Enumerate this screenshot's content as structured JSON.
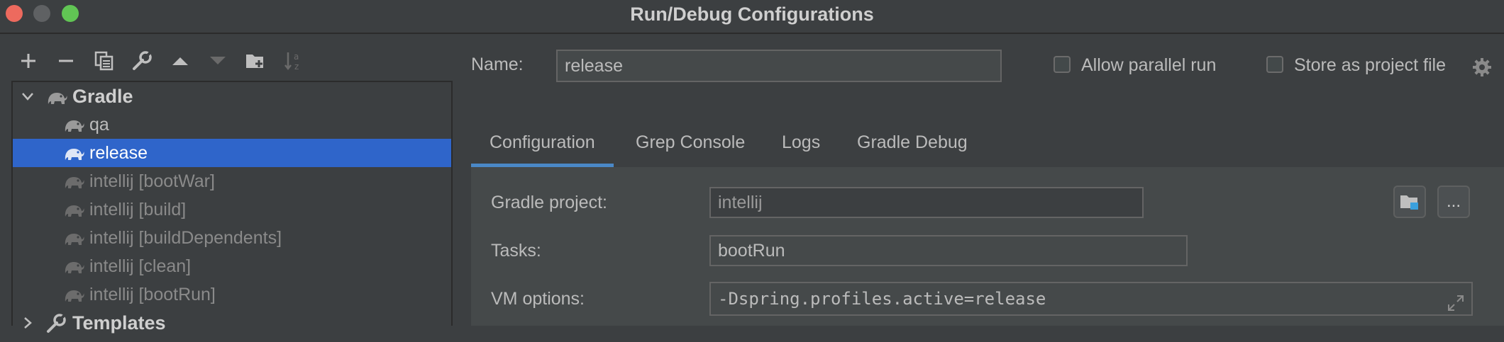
{
  "window": {
    "title": "Run/Debug Configurations"
  },
  "toolbar": {
    "buttons": [
      "add-icon",
      "remove-icon",
      "copy-icon",
      "wrench-icon",
      "move-up-icon",
      "move-down-icon",
      "new-folder-icon",
      "sort-icon"
    ]
  },
  "tree": {
    "group_label": "Gradle",
    "items": [
      {
        "label": "qa",
        "selected": false,
        "dim": false
      },
      {
        "label": "release",
        "selected": true,
        "dim": false
      },
      {
        "label": "intellij [bootWar]",
        "selected": false,
        "dim": true
      },
      {
        "label": "intellij [build]",
        "selected": false,
        "dim": true
      },
      {
        "label": "intellij [buildDependents]",
        "selected": false,
        "dim": true
      },
      {
        "label": "intellij [clean]",
        "selected": false,
        "dim": true
      },
      {
        "label": "intellij [bootRun]",
        "selected": false,
        "dim": true
      }
    ],
    "templates_label": "Templates"
  },
  "config": {
    "name_label": "Name:",
    "name_value": "release",
    "allow_parallel_label": "Allow parallel run",
    "store_project_label": "Store as project file",
    "allow_parallel_checked": false,
    "store_project_checked": false
  },
  "tabs": [
    {
      "label": "Configuration",
      "active": true
    },
    {
      "label": "Grep Console",
      "active": false
    },
    {
      "label": "Logs",
      "active": false
    },
    {
      "label": "Gradle Debug",
      "active": false
    }
  ],
  "form": {
    "gradle_project_label": "Gradle project:",
    "gradle_project_value": "intellij",
    "browse_button_label": "...",
    "tasks_label": "Tasks:",
    "tasks_value": "bootRun",
    "vm_options_label": "VM options:",
    "vm_options_value": "-Dspring.profiles.active=release"
  },
  "colors": {
    "background": "#3c3f41",
    "selection": "#2f65ca",
    "tab_underline": "#4a88c7",
    "panel": "#45494a"
  }
}
